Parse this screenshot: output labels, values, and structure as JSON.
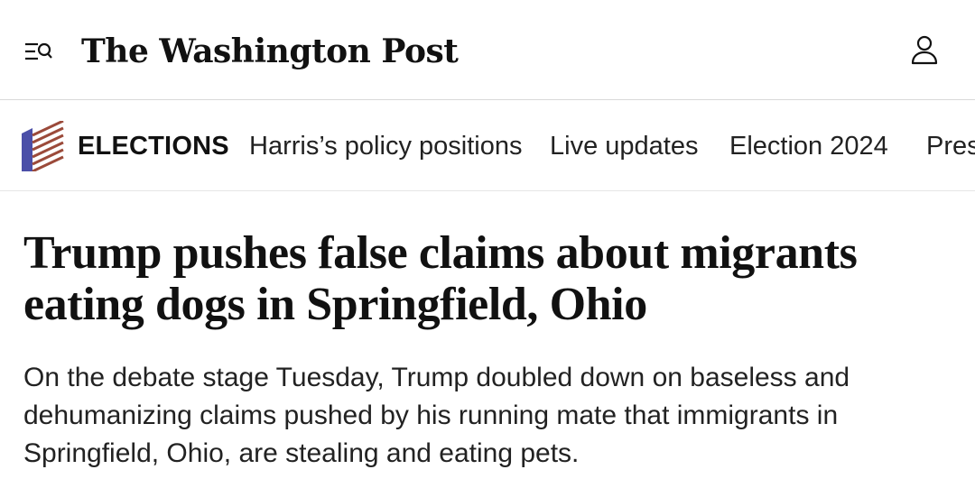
{
  "header": {
    "menu_icon": "menu-search-icon",
    "masthead": "The Washington Post",
    "account_icon": "user-account-icon"
  },
  "section_nav": {
    "section_icon": "elections-flag-icon",
    "section_label": "ELECTIONS",
    "links": [
      "Harris’s policy positions",
      "Live updates",
      "Election 2024",
      "Pres"
    ]
  },
  "article": {
    "headline": "Trump pushes false claims about migrants eating dogs in Springfield, Ohio",
    "dek": "On the debate stage Tuesday, Trump doubled down on baseless and dehumanizing claims pushed by his running mate that immigrants in Springfield, Ohio, are stealing and eating pets."
  },
  "colors": {
    "flag_blue": "#4b4fa8",
    "flag_stripe": "#9b4a3a",
    "divider": "#d9d9d9"
  }
}
